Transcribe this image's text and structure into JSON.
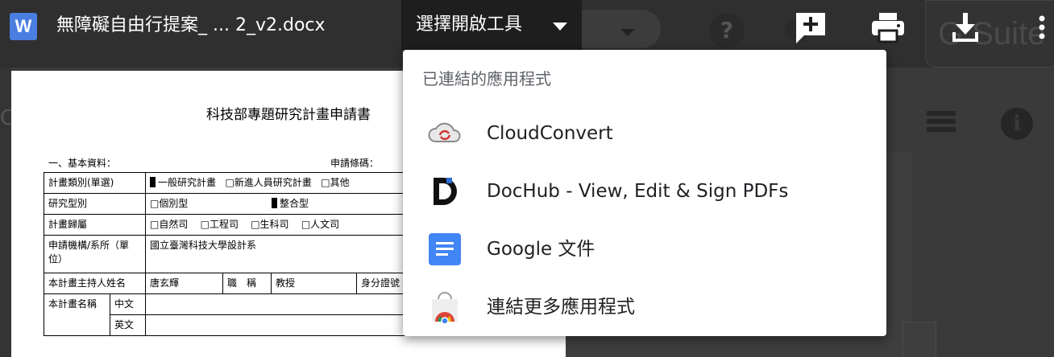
{
  "viewer": {
    "file_title": "無障礙自由行提案_ ... 2_v2.docx",
    "file_type_icon": "W",
    "open_with_label": "選擇開啟工具"
  },
  "background": {
    "gsuite_text": "G Suite",
    "help_glyph": "?",
    "info_glyph": "i",
    "left_glyph": "C"
  },
  "document": {
    "title": "科技部專題研究計畫申請書",
    "section_label": "一、基本資料：",
    "application_no_label": "申請條碼：",
    "rows": {
      "plan_type_label": "計畫類別(單選)",
      "plan_type_opt1": "一般研究計畫",
      "plan_type_opt2": "□新進人員研究計畫",
      "plan_type_opt3": "□其他",
      "research_type_label": "研究型別",
      "research_type_opt1": "□個別型",
      "research_type_opt2": "整合型",
      "division_label": "計畫歸屬",
      "division_opt1": "□自然司",
      "division_opt2": "□工程司",
      "division_opt3": "□生科司",
      "division_opt4": "□人文司",
      "institution_label": "申請機構/系所（單位）",
      "institution_value": "國立臺灣科技大學設計系",
      "pi_label": "本計畫主持人姓名",
      "pi_name": "唐玄輝",
      "title_label": "職　稱",
      "title_value": "教授",
      "id_label": "身分證號",
      "plan_name_label": "本計畫名稱",
      "chinese_label": "中文",
      "english_label": "英文"
    }
  },
  "dropdown": {
    "heading": "已連結的應用程式",
    "items": [
      {
        "label": "CloudConvert",
        "icon": "cloudconvert-icon"
      },
      {
        "label": "DocHub - View, Edit & Sign PDFs",
        "icon": "dochub-icon"
      },
      {
        "label": "Google 文件",
        "icon": "google-docs-icon"
      },
      {
        "label": "連結更多應用程式",
        "icon": "chrome-web-store-icon"
      }
    ]
  },
  "colors": {
    "word_blue": "#4a7ee0",
    "docs_blue": "#4285f4",
    "overlay_dark": "#1e1e1e"
  }
}
